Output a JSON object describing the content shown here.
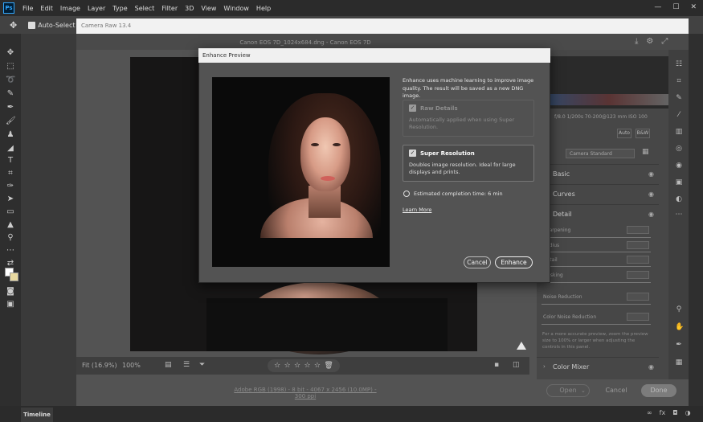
{
  "menubar": {
    "logo": "Ps",
    "items": [
      "File",
      "Edit",
      "Image",
      "Layer",
      "Type",
      "Select",
      "Filter",
      "3D",
      "View",
      "Window",
      "Help"
    ]
  },
  "optbar": {
    "auto_select": "Auto-Select"
  },
  "camera_raw": {
    "window_title": "Camera Raw 13.4",
    "file_name": "Canon EOS 7D_1024x684.dng - Canon EOS 7D",
    "exif": "f/8.0  1/200s  70-200@123 mm  ISO 100",
    "zoom_fit": "Fit (16.9%)",
    "zoom_pct": "100%",
    "metadata_link": "Adobe RGB (1998) - 8 bit - 4067 x 2456 (10.0MP) - 300 ppi",
    "buttons": {
      "open": "Open",
      "cancel": "Cancel",
      "done": "Done"
    },
    "panel": {
      "auto": "Auto",
      "bw": "B&W",
      "profile": "Camera Standard",
      "sections": {
        "basic": "Basic",
        "curves": "Curves",
        "detail": "Detail",
        "color_mixer": "Color Mixer"
      },
      "sliders": {
        "sharpening": "Sharpening",
        "radius": "Radius",
        "detail": "Detail",
        "masking": "Masking",
        "noise_reduction": "Noise Reduction",
        "color_noise_reduction": "Color Noise Reduction"
      },
      "note": "For a more accurate preview, zoom the preview size to 100% or larger when adjusting the controls in this panel."
    }
  },
  "dialog": {
    "title": "Enhance Preview",
    "description": "Enhance uses machine learning to improve image quality. The result will be saved as a new DNG image.",
    "raw_details": {
      "title": "Raw Details",
      "desc": "Automatically applied when using Super Resolution."
    },
    "super_resolution": {
      "title": "Super Resolution",
      "desc": "Doubles image resolution. Ideal for large displays and prints."
    },
    "estimate": "Estimated completion time: 6 min",
    "learn_more": "Learn More",
    "cancel": "Cancel",
    "enhance": "Enhance"
  },
  "timeline": {
    "label": "Timeline"
  }
}
